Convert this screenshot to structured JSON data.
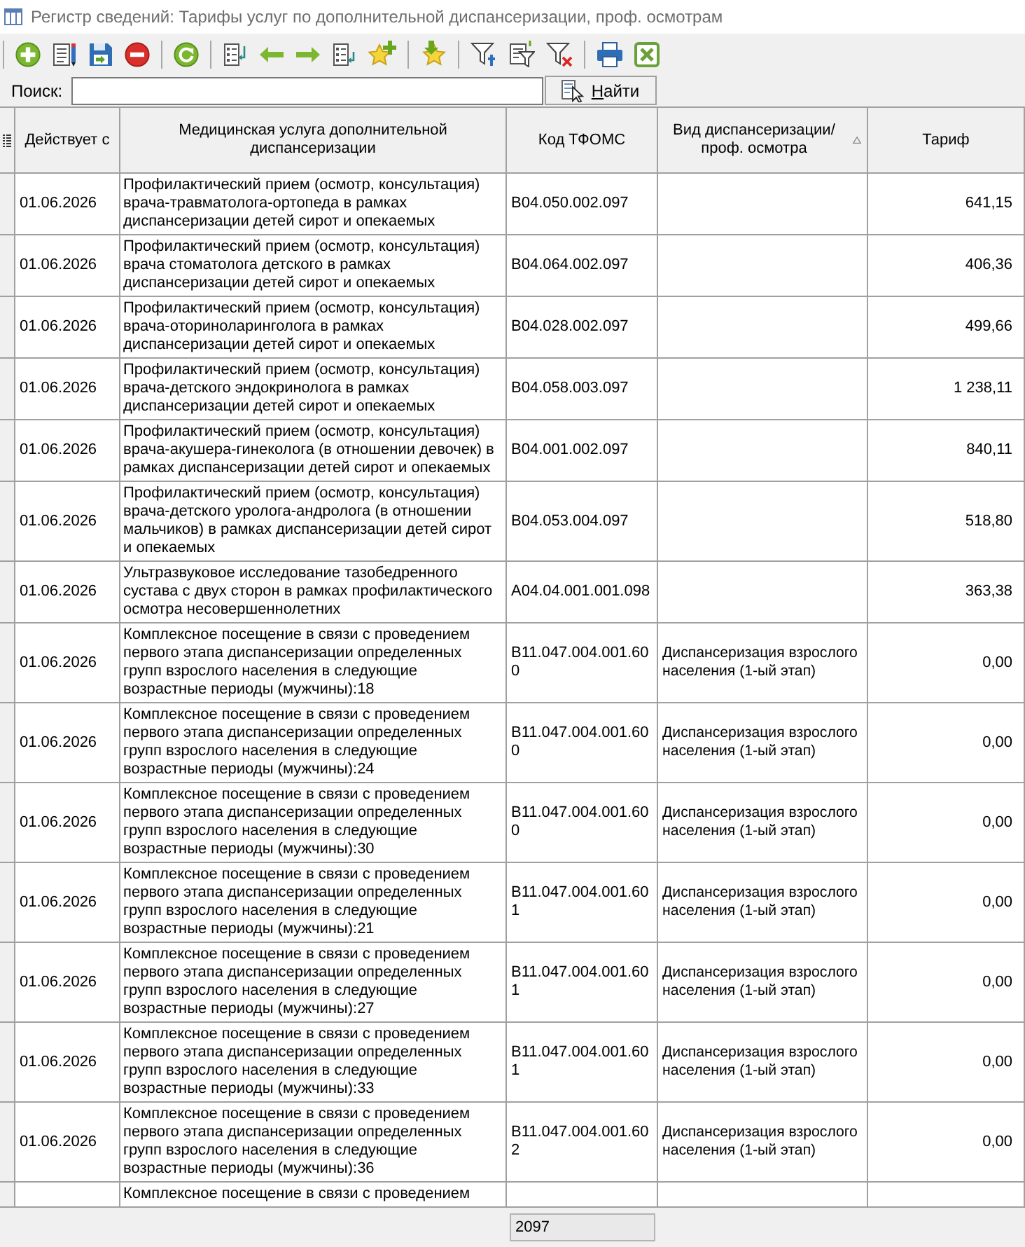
{
  "window": {
    "title": "Регистр сведений: Тарифы услуг по дополнительной диспансеризации, проф. осмотрам"
  },
  "search": {
    "label": "Поиск:",
    "button": "Найти"
  },
  "table": {
    "columns": [
      {
        "label": "Действует с",
        "sorted": false
      },
      {
        "label": "Медицинская услуга дополнительной диспансеризации",
        "sorted": false
      },
      {
        "label": "Код ТФОМС",
        "sorted": false
      },
      {
        "label": "Вид диспансеризации/проф. осмотра",
        "sorted": true
      },
      {
        "label": "Тариф",
        "sorted": false
      }
    ],
    "rows": [
      {
        "date": "01.06.2026",
        "service": "Профилактический прием (осмотр, консультация) врача-травматолога-ортопеда в рамках диспансеризации детей сирот и опекаемых",
        "code": "B04.050.002.097",
        "tariff": "641,15"
      },
      {
        "date": "01.06.2026",
        "service": "Профилактический прием (осмотр, консультация) врача стоматолога детского в рамках диспансеризации детей сирот и опекаемых",
        "code": "B04.064.002.097",
        "tariff": "406,36"
      },
      {
        "date": "01.06.2026",
        "service": "Профилактический прием (осмотр, консультация) врача-оториноларинголога в рамках диспансеризации детей сирот и опекаемых",
        "code": "B04.028.002.097",
        "tariff": "499,66"
      },
      {
        "date": "01.06.2026",
        "service": "Профилактический прием (осмотр, консультация) врача-детского эндокринолога в рамках диспансеризации детей сирот и опекаемых",
        "code": "B04.058.003.097",
        "tariff": "1 238,11"
      },
      {
        "date": "01.06.2026",
        "service": "Профилактический прием (осмотр, консультация) врача-акушера-гинеколога (в отношении девочек) в рамках диспансеризации детей сирот и опекаемых",
        "code": "B04.001.002.097",
        "tariff": "840,11"
      },
      {
        "date": "01.06.2026",
        "service": "Профилактический прием (осмотр, консультация) врача-детского уролога-андролога (в отношении мальчиков) в рамках диспансеризации детей сирот и опекаемых",
        "code": "B04.053.004.097",
        "tariff": "518,80"
      },
      {
        "date": "01.06.2026",
        "service": "Ультразвуковое исследование тазобедренного сустава с двух сторон в рамках профилактического осмотра несовершеннолетних",
        "code": "A04.04.001.001.098",
        "tariff": "363,38"
      },
      {
        "date": "01.06.2026",
        "service": "Комплексное посещение в связи с проведением первого этапа диспансеризации определенных групп взрослого населения в следующие возрастные периоды (мужчины):18",
        "code": "B11.047.004.001.600",
        "type": "Диспансеризация взрослого населения (1-ый этап)",
        "tariff": "0,00"
      },
      {
        "date": "01.06.2026",
        "service": "Комплексное посещение в связи с проведением первого этапа диспансеризации определенных групп взрослого населения в следующие возрастные периоды (мужчины):24",
        "code": "B11.047.004.001.600",
        "type": "Диспансеризация взрослого населения (1-ый этап)",
        "tariff": "0,00"
      },
      {
        "date": "01.06.2026",
        "service": "Комплексное посещение в связи с проведением первого этапа диспансеризации определенных групп взрослого населения в следующие возрастные периоды (мужчины):30",
        "code": "B11.047.004.001.600",
        "type": "Диспансеризация взрослого населения (1-ый этап)",
        "tariff": "0,00"
      },
      {
        "date": "01.06.2026",
        "service": "Комплексное посещение в связи с проведением первого этапа диспансеризации определенных групп взрослого населения в следующие возрастные периоды (мужчины):21",
        "code": "B11.047.004.001.601",
        "type": "Диспансеризация взрослого населения (1-ый этап)",
        "tariff": "0,00"
      },
      {
        "date": "01.06.2026",
        "service": "Комплексное посещение в связи с проведением первого этапа диспансеризации определенных групп взрослого населения в следующие возрастные периоды (мужчины):27",
        "code": "B11.047.004.001.601",
        "type": "Диспансеризация взрослого населения (1-ый этап)",
        "tariff": "0,00"
      },
      {
        "date": "01.06.2026",
        "service": "Комплексное посещение в связи с проведением первого этапа диспансеризации определенных групп взрослого населения в следующие возрастные периоды (мужчины):33",
        "code": "B11.047.004.001.601",
        "type": "Диспансеризация взрослого населения (1-ый этап)",
        "tariff": "0,00"
      },
      {
        "date": "01.06.2026",
        "service": "Комплексное посещение в связи с проведением первого этапа диспансеризации определенных групп взрослого населения в следующие возрастные периоды (мужчины):36",
        "code": "B11.047.004.001.602",
        "type": "Диспансеризация взрослого населения (1-ый этап)",
        "tariff": "0,00"
      },
      {
        "service": "Комплексное посещение в связи с проведением"
      }
    ]
  },
  "status_bar": {
    "count": "2097"
  }
}
